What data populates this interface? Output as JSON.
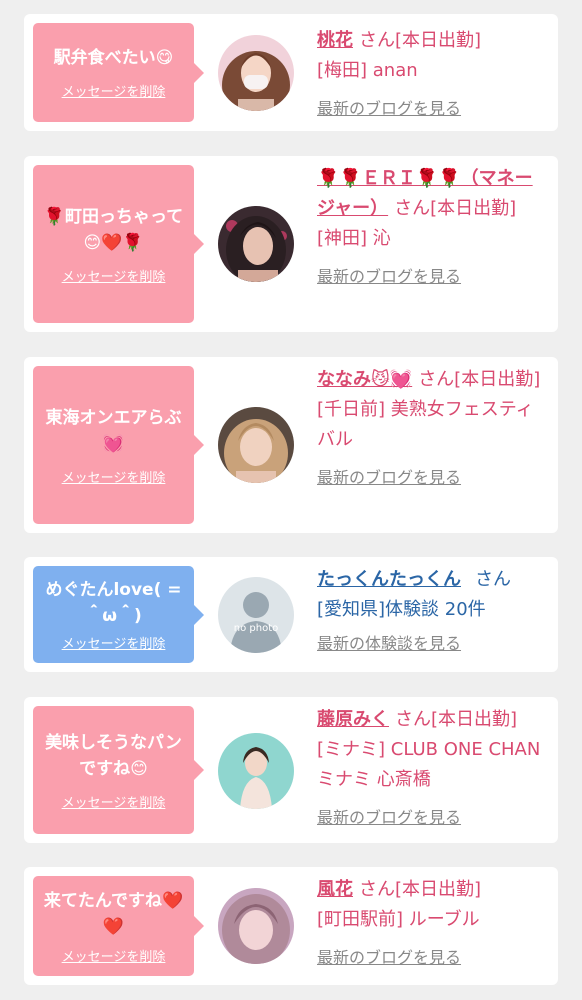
{
  "cards": [
    {
      "message": "駅弁食べたい😋",
      "delete_label": "メッセージを削除",
      "name": "桃花",
      "san": "さん[本日出勤]",
      "shop": "[梅田] anan",
      "link": "最新のブログを見る",
      "avatar_icon": "woman-with-mask-photo"
    },
    {
      "message": "🌹町田っちゃって😊❤️🌹",
      "delete_label": "メッセージを削除",
      "name": "🌹🌹ＥＲＩ🌹🌹（マネージャー）",
      "san": "さん[本日出勤]",
      "shop": "[神田] 沁",
      "link": "最新のブログを見る",
      "avatar_icon": "woman-photo"
    },
    {
      "message": "東海オンエアらぶ💓",
      "delete_label": "メッセージを削除",
      "name": "ななみ😼💓",
      "san": "さん[本日出勤]",
      "shop": "[千日前] 美熟女フェスティバル",
      "link": "最新のブログを見る",
      "avatar_icon": "woman-photo"
    },
    {
      "message": "めぐたんlove( = ＾ω＾)",
      "delete_label": "メッセージを削除",
      "name": "たっくんたっくん",
      "san": "さん",
      "shop": "[愛知県]体験談 20件",
      "link": "最新の体験談を見る",
      "avatar_icon": "no-photo-silhouette",
      "avatar_text": "no photo"
    },
    {
      "message": "美味しそうなパンですね😊",
      "delete_label": "メッセージを削除",
      "name": "藤原みく",
      "san": "さん[本日出勤]",
      "shop": "[ミナミ] CLUB ONE CHAN ミナミ 心斎橋",
      "link": "最新のブログを見る",
      "avatar_icon": "woman-photo"
    },
    {
      "message": "来てたんですね❤️❤️",
      "delete_label": "メッセージを削除",
      "name": "風花",
      "san": "さん[本日出勤]",
      "shop": "[町田駅前] ルーブル",
      "link": "最新のブログを見る",
      "avatar_icon": "woman-photo"
    }
  ],
  "colors": {
    "pink_bubble": "#fa9fad",
    "blue_bubble": "#7fb0ef",
    "pink_text": "#d94a70",
    "blue_text": "#2b66a6",
    "link_gray": "#888888"
  }
}
